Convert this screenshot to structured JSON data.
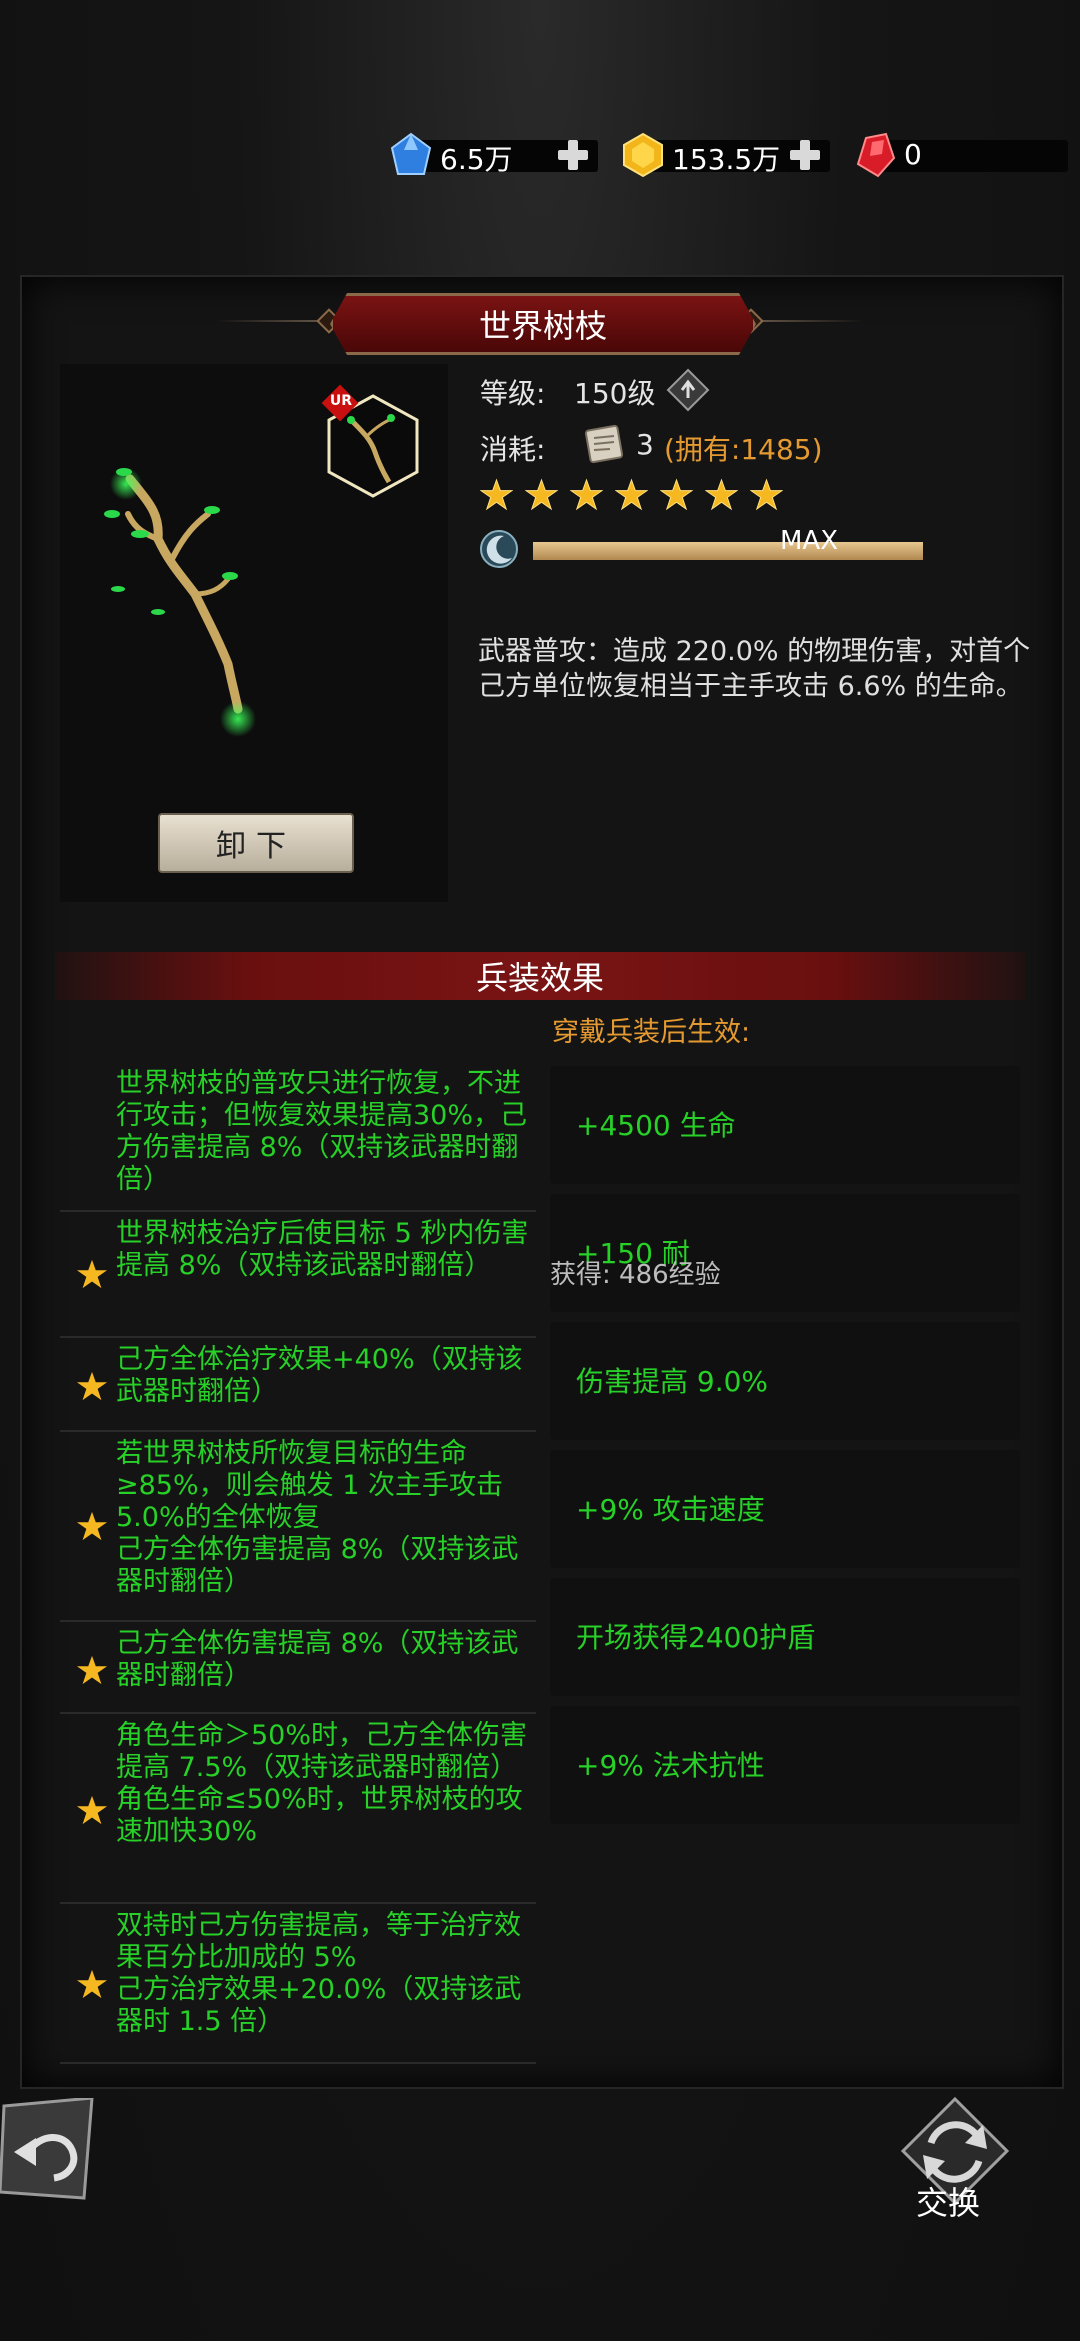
{
  "currency": [
    {
      "name": "blue-gem",
      "value": "6.5万",
      "color": "#3a8be8"
    },
    {
      "name": "gold-gem",
      "value": "153.5万",
      "color": "#f3c020"
    },
    {
      "name": "red-gem",
      "value": "0",
      "color": "#e0202a"
    }
  ],
  "item": {
    "title": "世界树枝",
    "rarity_badge": "UR",
    "level_label": "等级:",
    "level_value": "150级",
    "cost_label": "消耗:",
    "cost_value": "3",
    "owned_text": "(拥有:1485)",
    "star_count": 7,
    "xp_text": "MAX",
    "description": "武器普攻：造成 220.0% 的物理伤害，对首个己方单位恢复相当于主手攻击 6.6% 的生命。",
    "unequip_label": "卸下"
  },
  "effects": {
    "section_title": "兵装效果",
    "note": "穿戴兵装后生效:",
    "rows": [
      {
        "text": "世界树枝的普攻只进行恢复，不进行攻击；但恢复效果提高30%，己方伤害提高 8%（双持该武器时翻倍）",
        "starred": false
      },
      {
        "text": "世界树枝治疗后使目标 5 秒内伤害提高 8%（双持该武器时翻倍）",
        "starred": true
      },
      {
        "text": "己方全体治疗效果+40%（双持该武器时翻倍）",
        "starred": true
      },
      {
        "text": "若世界树枝所恢复目标的生命≥85%，则会触发 1 次主手攻击5.0%的全体恢复\n己方全体伤害提高 8%（双持该武器时翻倍）",
        "starred": true
      },
      {
        "text": "己方全体伤害提高 8%（双持该武器时翻倍）",
        "starred": true
      },
      {
        "text": "角色生命＞50%时，己方全体伤害提高 7.5%（双持该武器时翻倍）\n角色生命≤50%时，世界树枝的攻速加快30%",
        "starred": true
      },
      {
        "text": "双持时己方伤害提高，等于治疗效果百分比加成的 5%\n己方治疗效果+20.0%（双持该武器时 1.5 倍）",
        "starred": true
      }
    ],
    "bonuses": [
      "+4500 生命",
      "+150 耐",
      "伤害提高 9.0%",
      "+9% 攻击速度",
      "开场获得2400护盾",
      "+9% 法术抗性"
    ]
  },
  "floating_text": "获得: 486经验",
  "buttons": {
    "swap_label": "交换"
  },
  "colors": {
    "effect_green": "#27d127",
    "owned_orange": "#e49a30",
    "ribbon_red": "#7a1414"
  }
}
